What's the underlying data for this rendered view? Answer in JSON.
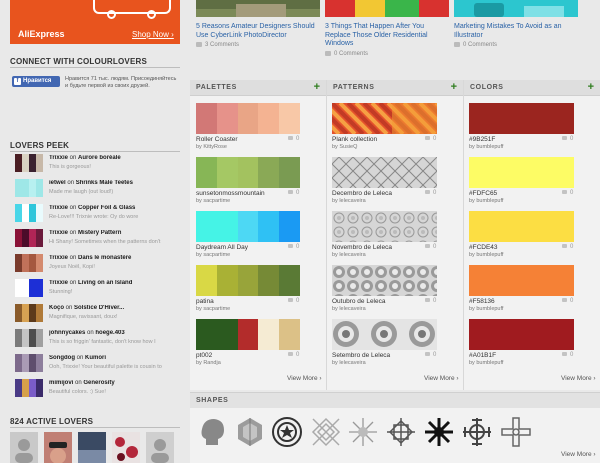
{
  "ad": {
    "brand": "AliExpress",
    "shop_label": "Shop Now ›"
  },
  "connect": {
    "title": "CONNECT WITH COLOURLOVERS",
    "like_label": "Нравится",
    "like_text": "Нравится 71 тыс. людям. Присоединяйтесь и будьте первой из своих друзей."
  },
  "peek": {
    "title": "LOVERS PEEK",
    "rows": [
      {
        "user": "Trixxie",
        "target": "Aurore boréale",
        "msg": "This is gorgeous!",
        "colors": [
          "#4a1d23",
          "#d9d2c2",
          "#3b2230",
          "#c7b8a8"
        ]
      },
      {
        "user": "ietwel",
        "target": "Shrinks Male Teetes",
        "msg": "Made me laugh (out loud!)",
        "colors": [
          "#9ee7e7",
          "#9ee7e7",
          "#b7f0f0",
          "#9ee7e7"
        ]
      },
      {
        "user": "Trixxie",
        "target": "Copper Foil & Glass",
        "msg": "Re-Love!!! Trixnie wrote: Oy do wore",
        "colors": [
          "#49d6e8",
          "#ffffff",
          "#2ec6db",
          "#e9fbfd"
        ]
      },
      {
        "user": "Trixxie",
        "target": "Mistery Pattern",
        "msg": "Hi Shany! Sometimes when the patterns don't",
        "colors": [
          "#8a1237",
          "#4b0c2a",
          "#b02556",
          "#6b1a3b"
        ]
      },
      {
        "user": "Trixxie",
        "target": "Dans le monastère",
        "msg": "Joyeux Noël, Kopi!",
        "colors": [
          "#7a3b2c",
          "#c0715a",
          "#a5583f",
          "#d48a6e"
        ]
      },
      {
        "user": "Trixxie",
        "target": "Living on an Island",
        "msg": "Stunning!",
        "colors": [
          "#ffffff",
          "#ffffff",
          "#1d2fd6",
          "#1d2fd6"
        ]
      },
      {
        "user": "Koço",
        "target": "Solstice D'Hiver...",
        "msg": "Magnifique, ravissant, doux!",
        "colors": [
          "#8a5b2a",
          "#d7a253",
          "#5c3a1b",
          "#b07a38"
        ]
      },
      {
        "user": "johnnycakes",
        "target": "hoege.403",
        "msg": "This is so friggin' fantastic, don't know how I",
        "colors": [
          "#7b7b7b",
          "#c4c4c4",
          "#4d4d4d",
          "#a0a0a0"
        ]
      },
      {
        "user": "Songdog",
        "target": "Kumori",
        "msg": "Ooh, Trixxie! Your beautiful palette is cousin to",
        "colors": [
          "#7d6a8b",
          "#aa9bb5",
          "#5e4e6d",
          "#8d7e9c"
        ]
      },
      {
        "user": "mimijovi",
        "target": "Generosity",
        "msg": "Beautiful colors. :) Sue!",
        "colors": [
          "#4a3b86",
          "#d6a04a",
          "#7a5cc8",
          "#3b2b6a"
        ]
      }
    ]
  },
  "active": {
    "title": "824 ACTIVE LOVERS"
  },
  "articles": [
    {
      "title": "5 Reasons Amateur Designers Should Use CyberLink PhotoDirector",
      "comments": "3 Comments"
    },
    {
      "title": "3 Things That Happen After You Replace Those Older Residential Windows",
      "comments": "0 Comments"
    },
    {
      "title": "Marketing Mistakes To Avoid as an Illustrator",
      "comments": "0 Comments"
    }
  ],
  "palettes": {
    "label": "PALETTES",
    "items": [
      {
        "title": "Roller Coaster",
        "by": "by KittyRose",
        "count": "0",
        "colors": [
          "#d27876",
          "#e6928a",
          "#e9a586",
          "#f4b392",
          "#f8c8a7"
        ]
      },
      {
        "title": "sunsetonmossmountain",
        "by": "by sacpartime",
        "count": "0",
        "colors": [
          "#87b656",
          "#a5c864",
          "#a3c25f",
          "#8aa956",
          "#7a9b52"
        ]
      },
      {
        "title": "Daydream All Day",
        "by": "by sacpartime",
        "count": "0",
        "colors": [
          "#45f3e6",
          "#45f3e6",
          "#4dd8f4",
          "#2fc1f4",
          "#1a9af3"
        ]
      },
      {
        "title": "patina",
        "by": "by sacpartime",
        "count": "0",
        "colors": [
          "#d9d845",
          "#a9b135",
          "#98a43a",
          "#768a36",
          "#5a7a35"
        ]
      },
      {
        "title": "pt002",
        "by": "by Randja",
        "count": "0",
        "colors": [
          "#2b5a1f",
          "#2b5a1f",
          "#b32c2b",
          "#f5ebd3",
          "#dcc187"
        ]
      }
    ],
    "view_more": "View More ›"
  },
  "patterns": {
    "label": "PATTERNS",
    "items": [
      {
        "title": "Plank collection",
        "by": "by SusieQ",
        "count": "0"
      },
      {
        "title": "Decembro de Leleca",
        "by": "by lelecaveira",
        "count": "0"
      },
      {
        "title": "Novembro de Leleca",
        "by": "by lelecaveira",
        "count": "0"
      },
      {
        "title": "Outubro de Leleca",
        "by": "by lelecaveira",
        "count": "0"
      },
      {
        "title": "Setembro de Leleca",
        "by": "by lelecaveira",
        "count": "0"
      }
    ],
    "view_more": "View More ›"
  },
  "colors": {
    "label": "COLORS",
    "items": [
      {
        "title": "#9B251F",
        "by": "by bumblepuff",
        "count": "0",
        "hex": "#9b251f"
      },
      {
        "title": "#FDFC65",
        "by": "by bumblepuff",
        "count": "0",
        "hex": "#fdfc65"
      },
      {
        "title": "#FCDE43",
        "by": "by bumblepuff",
        "count": "0",
        "hex": "#fcde43"
      },
      {
        "title": "#F58136",
        "by": "by bumblepuff",
        "count": "0",
        "hex": "#f58136"
      },
      {
        "title": "#A01B1F",
        "by": "by bumblepuff",
        "count": "0",
        "hex": "#a01b1f"
      }
    ],
    "view_more": "View More ›"
  },
  "shapes": {
    "label": "SHAPES",
    "icons": [
      "head-silhouette-shape",
      "hexagon-wrap-shape",
      "star-circle-shape",
      "lattice-shape",
      "starburst-shape",
      "cross-lattice-shape",
      "black-snowflake-shape",
      "cross-ornament-shape",
      "cross-ornament-outline-shape"
    ],
    "view_more": "View More ›"
  }
}
